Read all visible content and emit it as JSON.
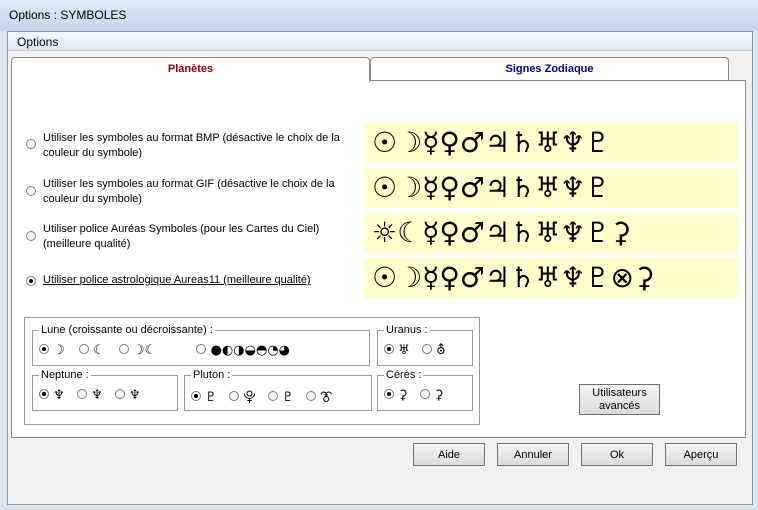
{
  "window": {
    "title": "Options : SYMBOLES"
  },
  "menu": {
    "options_label": "Options"
  },
  "tabs": [
    {
      "label": "Planètes"
    },
    {
      "label": "Signes Zodiaque"
    }
  ],
  "options": [
    {
      "label": "Utiliser les symboles au format BMP (désactive le choix de la couleur du symbole)",
      "symbols": "☉☽☿♀♂♃♄♅♆♇",
      "selected": false
    },
    {
      "label": "Utiliser les symboles au format GIF (désactive le choix de la couleur du symbole)",
      "symbols": "☉☽☿♀♂♃♄♅♆♇",
      "selected": false
    },
    {
      "label": "Utiliser police Auréas Symboles (pour les Cartes du Ciel) (meilleure qualité)",
      "symbols": "☼☾☿♀♂♃♄♅♆♇⚳",
      "selected": false
    },
    {
      "label": "Utiliser police astrologique Aureas11 (meilleure qualité)",
      "symbols": "☉☽☿♀♂♃♄♅♆♇⊗⚳",
      "selected": true
    }
  ],
  "groups": {
    "lune": {
      "title": "Lune (croissante ou décroissante) :",
      "choices": [
        "☽",
        "☾",
        "☽☾",
        "●◐◑◒◓◔◕"
      ]
    },
    "uranus": {
      "title": "Uranus :",
      "choices": [
        "♅",
        "⛢"
      ]
    },
    "neptune": {
      "title": "Neptune :",
      "choices": [
        "♆",
        "♆",
        "♆"
      ]
    },
    "pluton": {
      "title": "Pluton :",
      "choices": [
        "♇",
        "⯓",
        "♇",
        "⯔"
      ]
    },
    "ceres": {
      "title": "Cérès :",
      "choices": [
        "⚳",
        "⚳"
      ]
    }
  },
  "buttons": {
    "utilisateurs": "Utilisateurs avancés",
    "aide": "Aide",
    "annuler": "Annuler",
    "ok": "Ok",
    "apercu": "Aperçu"
  },
  "colors": {
    "active_tab": "#8b0000",
    "inactive_tab": "#000080",
    "symbol_bg": "#ffffcc"
  }
}
